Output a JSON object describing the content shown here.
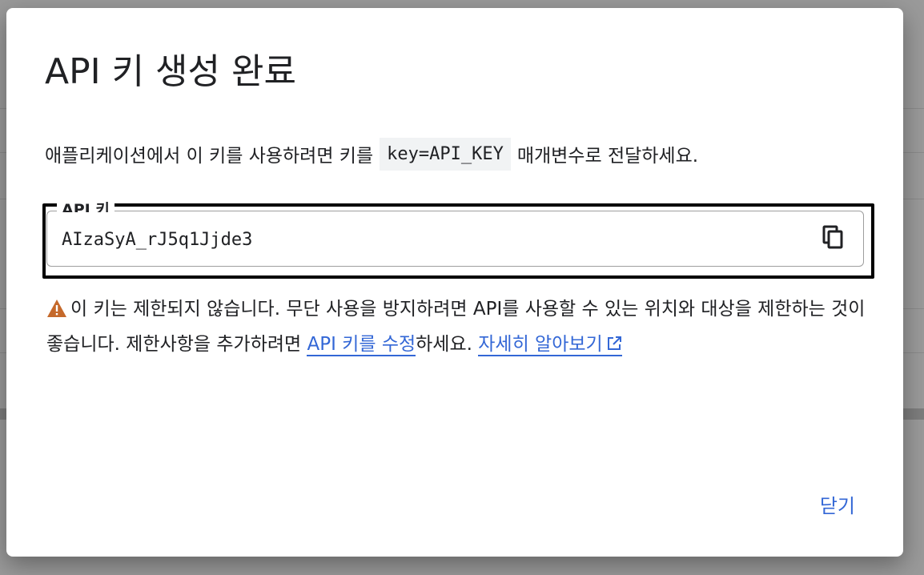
{
  "dialog": {
    "title": "API 키 생성 완료",
    "description_before": "애플리케이션에서 이 키를 사용하려면 키를",
    "code_param": "key=API_KEY",
    "description_after": "매개변수로 전달하세요.",
    "field": {
      "label": "API 키",
      "value": "AIzaSyA_rJ5q1Jjde3",
      "copy_icon": "content-copy-icon"
    },
    "warning": {
      "icon": "warning-icon",
      "text_before": "이 키는 제한되지 않습니다. 무단 사용을 방지하려면 API를 사용할 수 있는 위치와 대상을 제한하는 것이 좋습니다. 제한사항을 추가하려면 ",
      "edit_link": "API 키를 수정",
      "text_middle": "하세요. ",
      "learn_more_link": "자세히 알아보기",
      "external_icon": "open-in-new-icon"
    },
    "close_label": "닫기"
  },
  "colors": {
    "link": "#3367d6",
    "warning": "#c5692b",
    "overlay": "#9a9a9a"
  }
}
